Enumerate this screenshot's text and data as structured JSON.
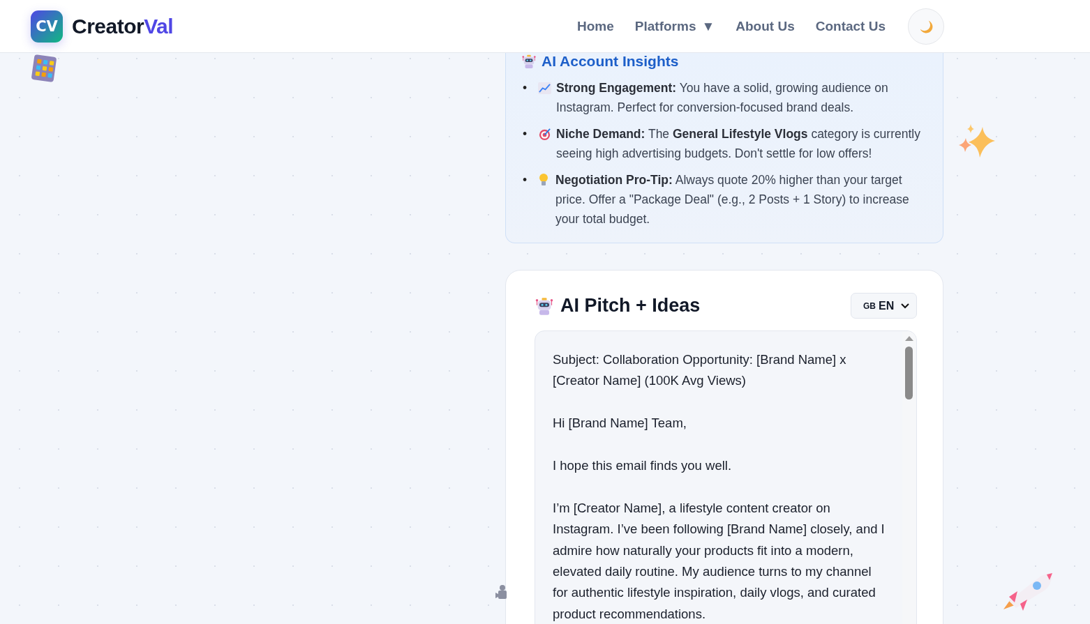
{
  "header": {
    "logo_mark": "CV",
    "brand": "Creator",
    "brand_accent": "Val",
    "nav": [
      {
        "label": "Home"
      },
      {
        "label": "Platforms",
        "caret": "▼"
      },
      {
        "label": "About Us"
      },
      {
        "label": "Contact Us"
      }
    ]
  },
  "insights": {
    "title": "AI Account Insights",
    "items": [
      {
        "kind": "chart",
        "bullet": "•",
        "text": "**Strong Engagement:** You have a solid, growing audience on Instagram. Perfect for conversion-focused brand deals."
      },
      {
        "kind": "target",
        "bullet": "•",
        "text": "**Niche Demand:** The **General Lifestyle Vlogs** category is currently seeing high advertising budgets. Don't settle for low offers!"
      },
      {
        "kind": "bulb",
        "bullet": "•",
        "text": "**Negotiation Pro-Tip:** Always quote 20% higher than your target price. Offer a \"Package Deal\" (e.g., 2 Posts + 1 Story) to increase your total budget."
      }
    ]
  },
  "pitch": {
    "title": "AI Pitch + Ideas",
    "language": {
      "flag": "GB",
      "code": "EN"
    },
    "paragraphs": [
      "Subject: Collaboration Opportunity: [Brand Name] x [Creator Name] (100K Avg Views)",
      "Hi [Brand Name] Team,",
      "I hope this email finds you well.",
      "I’m [Creator Name], a lifestyle content creator on Instagram. I’ve been following [Brand Name] closely, and I admire how naturally your products fit into a modern, elevated daily routine. My audience turns to my channel for authentic lifestyle inspiration, daily vlogs, and curated product recommendations."
    ]
  }
}
